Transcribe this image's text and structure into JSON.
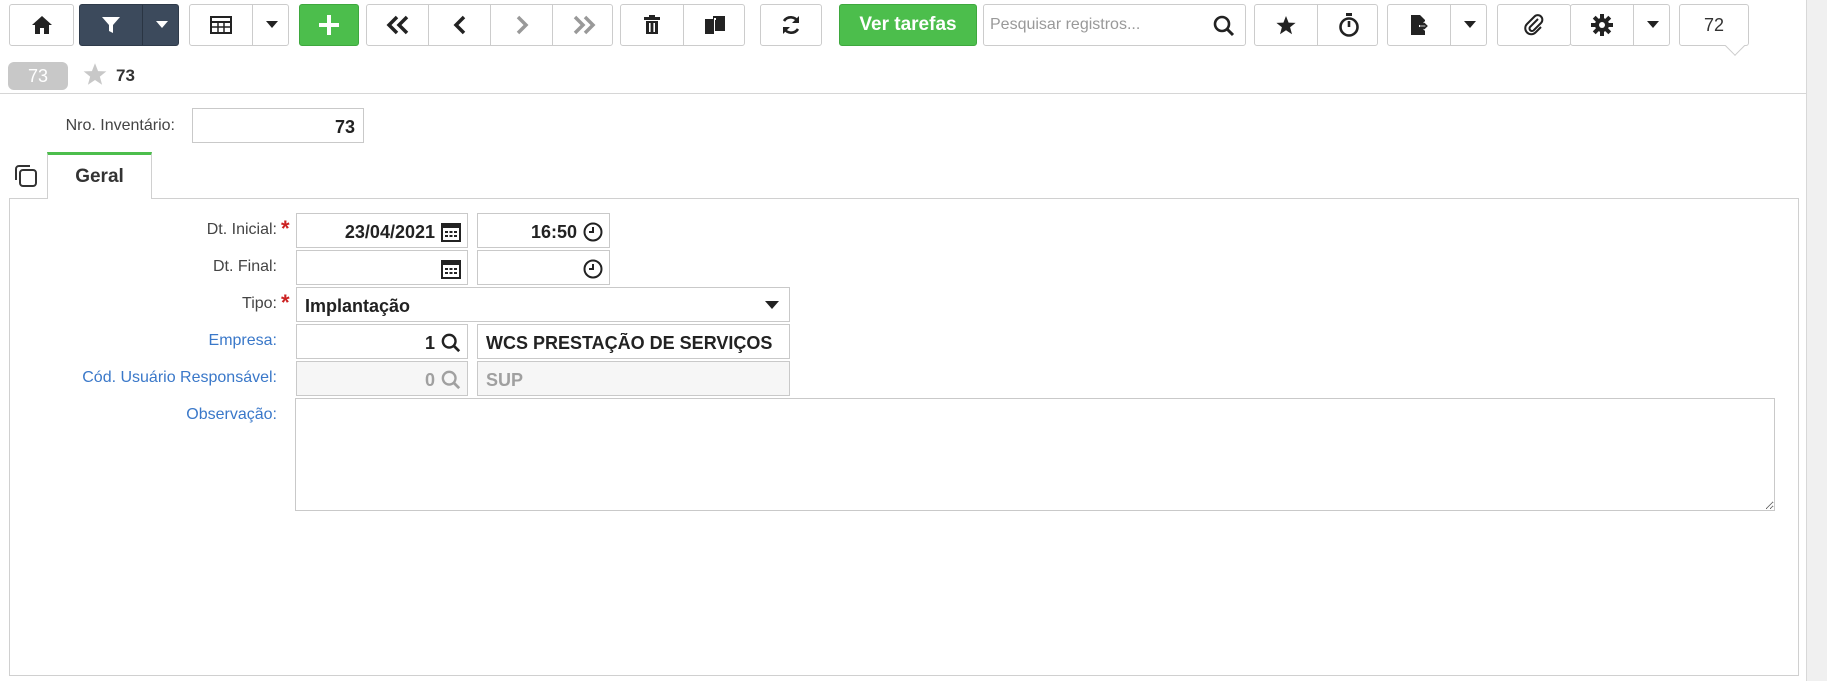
{
  "toolbar": {
    "action_label": "Ver tarefas",
    "search_placeholder": "Pesquisar registros...",
    "record_count": "72"
  },
  "record": {
    "badge": "73",
    "title": "73"
  },
  "inventory": {
    "label": "Nro. Inventário:",
    "value": "73"
  },
  "tabs": [
    {
      "label": "Geral"
    }
  ],
  "form": {
    "dt_inicial": {
      "label": "Dt. Inicial:",
      "date": "23/04/2021",
      "time": "16:50"
    },
    "dt_final": {
      "label": "Dt. Final:",
      "date": "",
      "time": ""
    },
    "tipo": {
      "label": "Tipo:",
      "value": "Implantação"
    },
    "empresa": {
      "label": "Empresa:",
      "code": "1",
      "name": "WCS PRESTAÇÃO DE SERVIÇOS"
    },
    "usuario": {
      "label": "Cód. Usuário Responsável:",
      "code": "0",
      "name": "SUP"
    },
    "observacao": {
      "label": "Observação:",
      "value": ""
    }
  },
  "colors": {
    "toolbar_dark": "#3c4a5c",
    "accent_green": "#4cbe4c",
    "link_blue": "#3a78c9",
    "required_red": "#cc2222"
  },
  "icons": [
    "home-icon",
    "filter-icon",
    "table-icon",
    "plus-icon",
    "first-icon",
    "prev-icon",
    "next-icon",
    "last-icon",
    "trash-icon",
    "copy-icon",
    "refresh-icon",
    "search-icon",
    "star-icon",
    "stopwatch-icon",
    "export-icon",
    "paperclip-icon",
    "gear-icon",
    "calendar-icon",
    "clock-icon",
    "chevron-down-icon",
    "duplicate-icon"
  ]
}
